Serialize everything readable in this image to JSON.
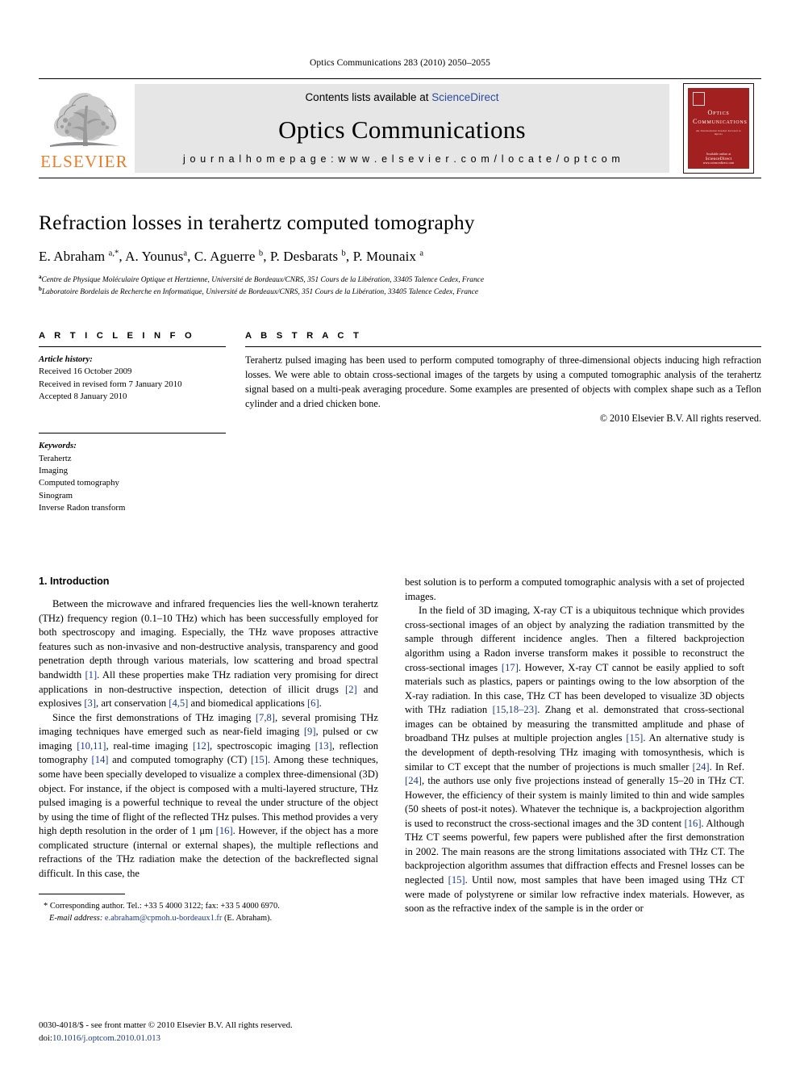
{
  "running_head": "Optics Communications 283 (2010) 2050–2055",
  "banner": {
    "publisher_name": "ELSEVIER",
    "contents_prefix": "Contents lists available at ",
    "contents_link": "ScienceDirect",
    "journal_name": "Optics Communications",
    "homepage": "j o u r n a l   h o m e p a g e :   w w w . e l s e v i e r . c o m / l o c a t e / o p t c o m",
    "cover": {
      "title": "Optics Communications",
      "subtitle": "An International Journal devoted to Optics",
      "footer_label": "Available online at",
      "footer_brand": "ScienceDirect",
      "footer_url": "www.sciencedirect.com"
    }
  },
  "article": {
    "title": "Refraction losses in terahertz computed tomography",
    "authors": "E. Abraham ^a,*, A. Younus ^a, C. Aguerre ^b, P. Desbarats ^b, P. Mounaix ^a",
    "authors_parts": [
      {
        "name": "E. Abraham ",
        "sup": "a,*"
      },
      {
        "name": ", A. Younus",
        "sup": "a"
      },
      {
        "name": ", C. Aguerre ",
        "sup": "b"
      },
      {
        "name": ", P. Desbarats ",
        "sup": "b"
      },
      {
        "name": ", P. Mounaix ",
        "sup": "a"
      }
    ],
    "affiliations": [
      {
        "marker": "a",
        "text": "Centre de Physique Moléculaire Optique et Hertzienne, Université de Bordeaux/CNRS, 351 Cours de la Libération, 33405 Talence Cedex, France"
      },
      {
        "marker": "b",
        "text": "Laboratoire Bordelais de Recherche en Informatique, Université de Bordeaux/CNRS, 351 Cours de la Libération, 33405 Talence Cedex, France"
      }
    ]
  },
  "article_info": {
    "heading": "A R T I C L E   I N F O",
    "history_label": "Article history:",
    "history": [
      "Received 16 October 2009",
      "Received in revised form 7 January 2010",
      "Accepted 8 January 2010"
    ],
    "keywords_label": "Keywords:",
    "keywords": [
      "Terahertz",
      "Imaging",
      "Computed tomography",
      "Sinogram",
      "Inverse Radon transform"
    ]
  },
  "abstract": {
    "heading": "A B S T R A C T",
    "text": "Terahertz pulsed imaging has been used to perform computed tomography of three-dimensional objects inducing high refraction losses. We were able to obtain cross-sectional images of the targets by using a computed tomographic analysis of the terahertz signal based on a multi-peak averaging procedure. Some examples are presented of objects with complex shape such as a Teflon cylinder and a dried chicken bone.",
    "copyright": "© 2010 Elsevier B.V. All rights reserved."
  },
  "body": {
    "section_heading": "1. Introduction",
    "left_paragraphs": [
      "Between the microwave and infrared frequencies lies the well-known terahertz (THz) frequency region (0.1–10 THz) which has been successfully employed for both spectroscopy and imaging. Especially, the THz wave proposes attractive features such as non-invasive and non-destructive analysis, transparency and good penetration depth through various materials, low scattering and broad spectral bandwidth [1]. All these properties make THz radiation very promising for direct applications in non-destructive inspection, detection of illicit drugs [2] and explosives [3], art conservation [4,5] and biomedical applications [6].",
      "Since the first demonstrations of THz imaging [7,8], several promising THz imaging techniques have emerged such as near-field imaging [9], pulsed or cw imaging [10,11], real-time imaging [12], spectroscopic imaging [13], reflection tomography [14] and computed tomography (CT) [15]. Among these techniques, some have been specially developed to visualize a complex three-dimensional (3D) object. For instance, if the object is composed with a multi-layered structure, THz pulsed imaging is a powerful technique to reveal the under structure of the object by using the time of flight of the reflected THz pulses. This method provides a very high depth resolution in the order of 1 μm [16]. However, if the object has a more complicated structure (internal or external shapes), the multiple reflections and refractions of the THz radiation make the detection of the backreflected signal difficult. In this case, the"
    ],
    "right_paragraphs": [
      "best solution is to perform a computed tomographic analysis with a set of projected images.",
      "In the field of 3D imaging, X-ray CT is a ubiquitous technique which provides cross-sectional images of an object by analyzing the radiation transmitted by the sample through different incidence angles. Then a filtered backprojection algorithm using a Radon inverse transform makes it possible to reconstruct the cross-sectional images [17]. However, X-ray CT cannot be easily applied to soft materials such as plastics, papers or paintings owing to the low absorption of the X-ray radiation. In this case, THz CT has been developed to visualize 3D objects with THz radiation [15,18–23]. Zhang et al. demonstrated that cross-sectional images can be obtained by measuring the transmitted amplitude and phase of broadband THz pulses at multiple projection angles [15]. An alternative study is the development of depth-resolving THz imaging with tomosynthesis, which is similar to CT except that the number of projections is much smaller [24]. In Ref. [24], the authors use only five projections instead of generally 15–20 in THz CT. However, the efficiency of their system is mainly limited to thin and wide samples (50 sheets of post-it notes). Whatever the technique is, a backprojection algorithm is used to reconstruct the cross-sectional images and the 3D content [16]. Although THz CT seems powerful, few papers were published after the first demonstration in 2002. The main reasons are the strong limitations associated with THz CT. The backprojection algorithm assumes that diffraction effects and Fresnel losses can be neglected [15]. Until now, most samples that have been imaged using THz CT were made of polystyrene or similar low refractive index materials. However, as soon as the refractive index of the sample is in the order or"
    ]
  },
  "footnote": {
    "marker": "*",
    "corresponding": "Corresponding author. Tel.: +33 5 4000 3122; fax: +33 5 4000 6970.",
    "email_label": "E-mail address:",
    "email": "e.abraham@cpmoh.u-bordeaux1.fr",
    "email_suffix": "(E. Abraham)."
  },
  "page_footer": {
    "issn_line": "0030-4018/$ - see front matter © 2010 Elsevier B.V. All rights reserved.",
    "doi_label": "doi:",
    "doi": "10.1016/j.optcom.2010.01.013"
  },
  "colors": {
    "link_blue": "#2a4b9b",
    "reference_blue": "#1b3a8c",
    "elsevier_orange": "#ec7c26",
    "cover_red": "#a32020",
    "banner_gray": "#e6e6e6"
  }
}
